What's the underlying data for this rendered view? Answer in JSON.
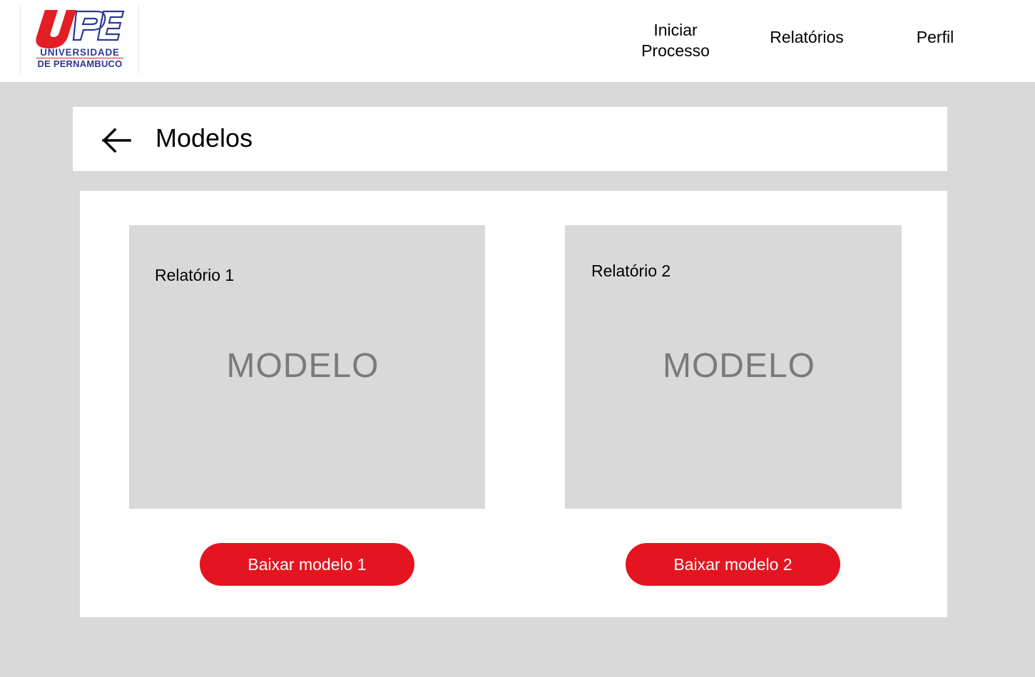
{
  "logo": {
    "line1": "UNIVERSIDADE",
    "line2": "DE PERNAMBUCO"
  },
  "nav": {
    "items": [
      {
        "label": "Iniciar Processo",
        "line1": "Iniciar",
        "line2": "Processo"
      },
      {
        "label": "Relatórios"
      },
      {
        "label": "Perfil"
      }
    ]
  },
  "header": {
    "back_icon": "arrow-left-icon",
    "title": "Modelos"
  },
  "models": [
    {
      "label": "Relatório 1",
      "placeholder": "MODELO",
      "button_label": "Baixar modelo 1"
    },
    {
      "label": "Relatório 2",
      "placeholder": "MODELO",
      "button_label": "Baixar modelo 2"
    }
  ],
  "colors": {
    "accent": "#e41520",
    "brand_blue": "#2b3990",
    "background": "#d9d9d9",
    "placeholder_text": "#7a7a7a"
  }
}
